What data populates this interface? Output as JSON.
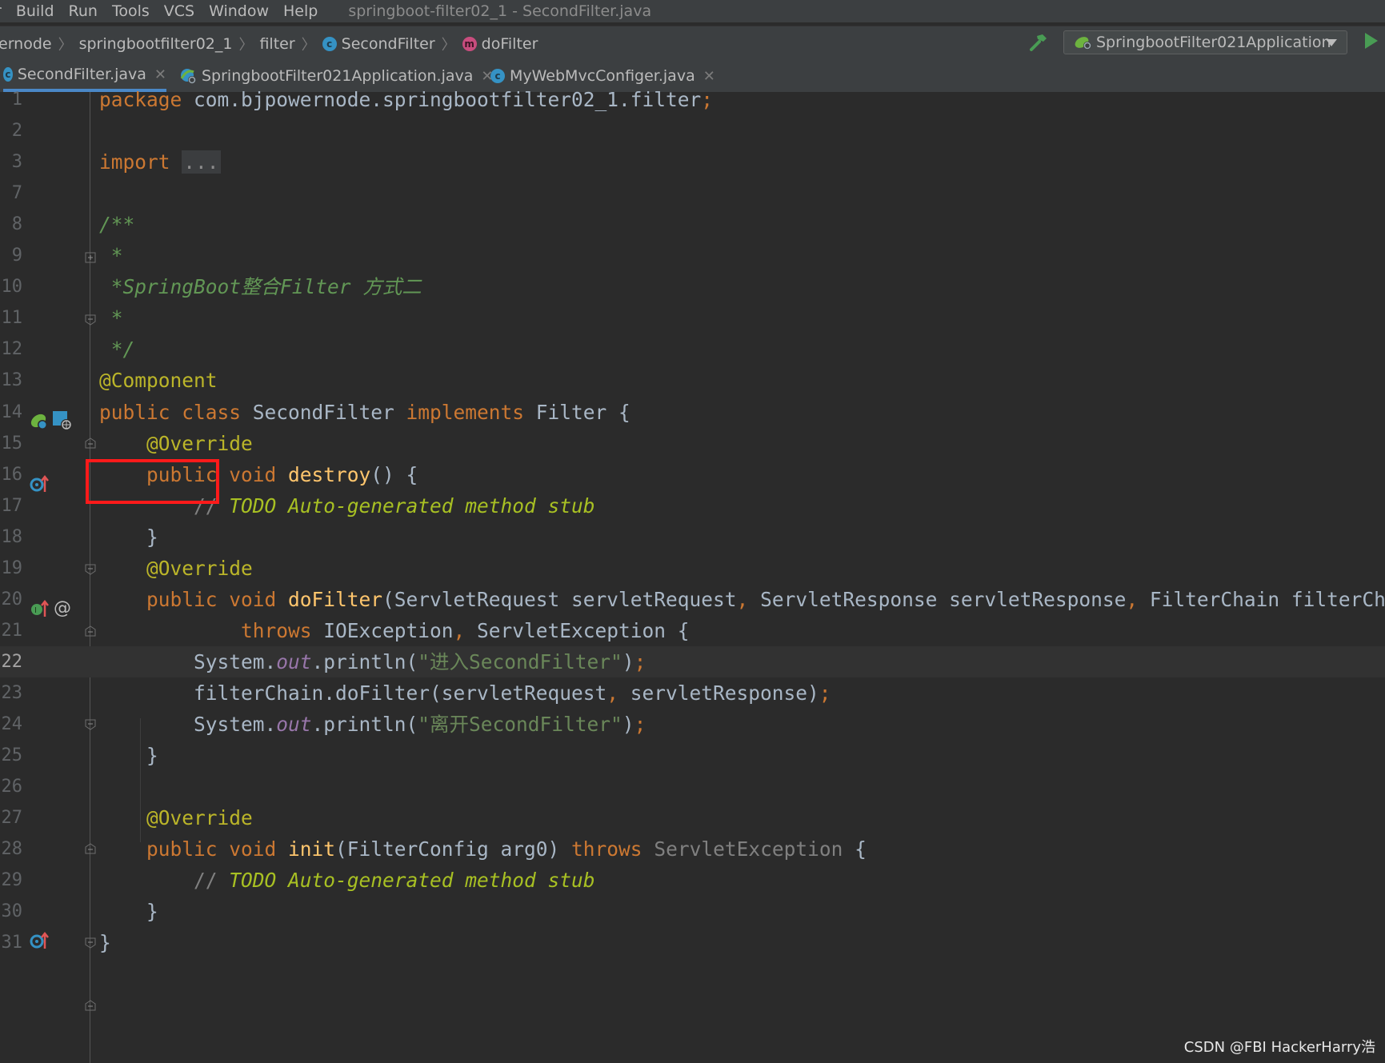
{
  "menu": {
    "items": [
      "r",
      "Build",
      "Run",
      "Tools",
      "VCS",
      "Window",
      "Help"
    ],
    "window_title": "springboot-filter02_1 - SecondFilter.java"
  },
  "breadcrumb": {
    "items": [
      "ernode",
      "springbootfilter02_1",
      "filter",
      "SecondFilter",
      "doFilter"
    ]
  },
  "run_config": {
    "label": "SpringbootFilter021Application"
  },
  "tabs": [
    {
      "label": "SecondFilter.java",
      "active": true
    },
    {
      "label": "SpringbootFilter021Application.java",
      "active": false
    },
    {
      "label": "MyWebMvcConfiger.java",
      "active": false
    }
  ],
  "editor": {
    "current_line": "22",
    "lines": [
      {
        "num": "1",
        "segments": [
          [
            "kw",
            "package "
          ],
          [
            "cls",
            "com.bjpowernode.springbootfilter02_1.filter"
          ],
          [
            "punc",
            ";"
          ]
        ]
      },
      {
        "num": "2",
        "segments": []
      },
      {
        "num": "3",
        "segments": [
          [
            "kw",
            "import "
          ],
          [
            "fold",
            "..."
          ]
        ]
      },
      {
        "num": "7",
        "segments": []
      },
      {
        "num": "8",
        "segments": [
          [
            "cmt",
            "/**"
          ]
        ]
      },
      {
        "num": "9",
        "segments": [
          [
            "cmt",
            " *"
          ]
        ]
      },
      {
        "num": "10",
        "segments": [
          [
            "cmt",
            " *SpringBoot整合Filter 方式二"
          ]
        ]
      },
      {
        "num": "11",
        "segments": [
          [
            "cmt",
            " *"
          ]
        ]
      },
      {
        "num": "12",
        "segments": [
          [
            "cmt",
            " */"
          ]
        ]
      },
      {
        "num": "13",
        "segments": [
          [
            "ann",
            "@Component"
          ]
        ]
      },
      {
        "num": "14",
        "segments": [
          [
            "kw",
            "public class "
          ],
          [
            "cls",
            "SecondFilter "
          ],
          [
            "kw",
            "implements "
          ],
          [
            "cls",
            "Filter {"
          ]
        ]
      },
      {
        "num": "15",
        "segments": [
          [
            "cls",
            "    "
          ],
          [
            "ann",
            "@Override"
          ]
        ]
      },
      {
        "num": "16",
        "segments": [
          [
            "kw",
            "    public void "
          ],
          [
            "fn",
            "destroy"
          ],
          [
            "cls",
            "() {"
          ]
        ]
      },
      {
        "num": "17",
        "segments": [
          [
            "lcmt",
            "        // "
          ],
          [
            "todo",
            "TODO Auto-generated method stub"
          ]
        ]
      },
      {
        "num": "18",
        "segments": [
          [
            "cls",
            "    }"
          ]
        ]
      },
      {
        "num": "19",
        "segments": [
          [
            "cls",
            "    "
          ],
          [
            "ann",
            "@Override"
          ]
        ]
      },
      {
        "num": "20",
        "segments": [
          [
            "kw",
            "    public void "
          ],
          [
            "fn",
            "doFilter"
          ],
          [
            "cls",
            "(ServletRequest servletRequest"
          ],
          [
            "punc",
            ", "
          ],
          [
            "cls",
            "ServletResponse servletResponse"
          ],
          [
            "punc",
            ", "
          ],
          [
            "cls",
            "FilterChain filterChain)"
          ]
        ]
      },
      {
        "num": "21",
        "segments": [
          [
            "kw",
            "            throws "
          ],
          [
            "cls",
            "IOException"
          ],
          [
            "punc",
            ", "
          ],
          [
            "cls",
            "ServletException {"
          ]
        ]
      },
      {
        "num": "22",
        "segments": [
          [
            "cls",
            "        System."
          ],
          [
            "fld",
            "out"
          ],
          [
            "cls",
            ".println("
          ],
          [
            "str",
            "\"进入SecondFilter\""
          ],
          [
            "cls",
            ")"
          ],
          [
            "punc",
            ";"
          ]
        ]
      },
      {
        "num": "23",
        "segments": [
          [
            "cls",
            "        filterChain.doFilter(servletRequest"
          ],
          [
            "punc",
            ", "
          ],
          [
            "cls",
            "servletResponse)"
          ],
          [
            "punc",
            ";"
          ]
        ]
      },
      {
        "num": "24",
        "segments": [
          [
            "cls",
            "        System."
          ],
          [
            "fld",
            "out"
          ],
          [
            "cls",
            ".println("
          ],
          [
            "str",
            "\"离开SecondFilter\""
          ],
          [
            "cls",
            ")"
          ],
          [
            "punc",
            ";"
          ]
        ]
      },
      {
        "num": "25",
        "segments": [
          [
            "cls",
            "    }"
          ]
        ]
      },
      {
        "num": "26",
        "segments": []
      },
      {
        "num": "27",
        "segments": [
          [
            "cls",
            "    "
          ],
          [
            "ann",
            "@Override"
          ]
        ]
      },
      {
        "num": "28",
        "segments": [
          [
            "kw",
            "    public void "
          ],
          [
            "fn",
            "init"
          ],
          [
            "cls",
            "(FilterConfig arg0) "
          ],
          [
            "kw",
            "throws "
          ],
          [
            "dim",
            "ServletException "
          ],
          [
            "cls",
            "{"
          ]
        ]
      },
      {
        "num": "29",
        "segments": [
          [
            "lcmt",
            "        // "
          ],
          [
            "todo",
            "TODO Auto-generated method stub"
          ]
        ]
      },
      {
        "num": "30",
        "segments": [
          [
            "cls",
            "    }"
          ]
        ]
      },
      {
        "num": "31",
        "segments": [
          [
            "cls",
            "}"
          ]
        ]
      }
    ]
  },
  "watermark": "CSDN @FBI HackerHarry浩",
  "colors": {
    "keyword": "#cc7832",
    "annotation": "#bbb529",
    "string": "#6a8759",
    "doc_comment": "#629755",
    "method": "#ffc66d",
    "highlight_box": "#ff1a1a"
  }
}
